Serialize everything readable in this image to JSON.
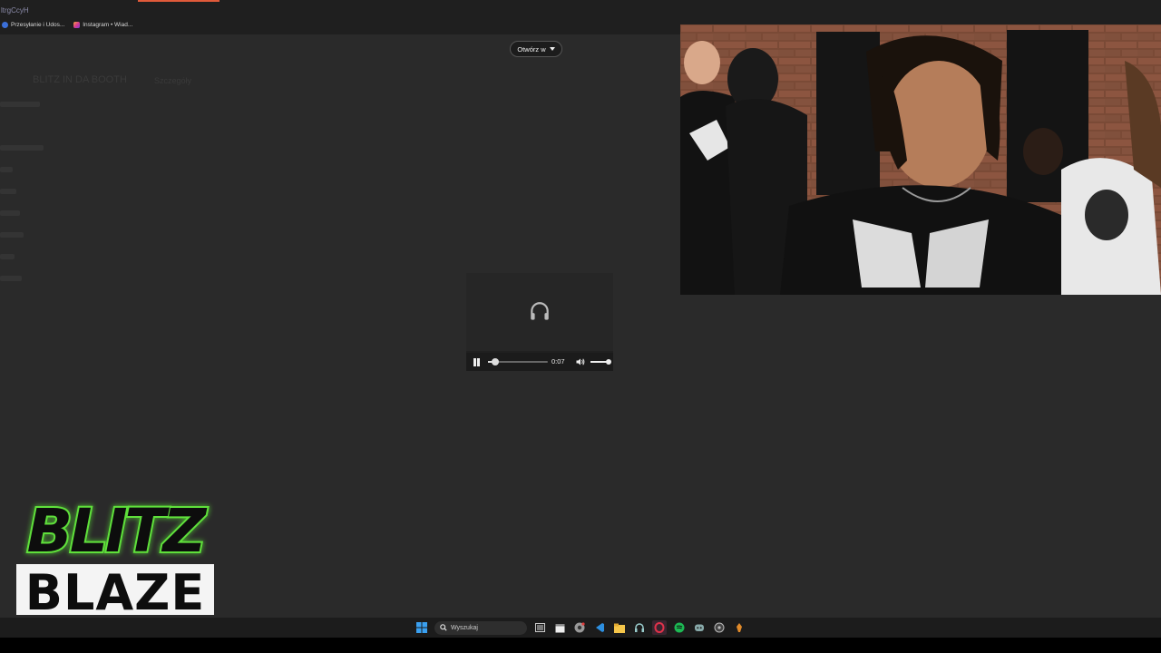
{
  "browser": {
    "url_fragment": "ltrgCcyH",
    "bookmarks": [
      {
        "label": "Przesyłanie i Udos...",
        "icon": "facebook-icon"
      },
      {
        "label": "Instagram • Wiad...",
        "icon": "instagram-icon"
      }
    ]
  },
  "page": {
    "open_in_label": "Otwórz w",
    "dim_title": "BLITZ IN DA BOOTH",
    "dim_subtitle": "Szczegóły"
  },
  "audio_player": {
    "time": "0:07",
    "progress": 0.12,
    "volume": 1.0
  },
  "logo": {
    "line1": "BLITZ",
    "line2": "BLAZE"
  },
  "taskbar": {
    "search_placeholder": "Wyszukaj",
    "apps": [
      "start-icon",
      "search-icon",
      "task-view-icon",
      "calendar-icon",
      "chrome-icon",
      "vscode-icon",
      "file-explorer-icon",
      "headset-icon",
      "opera-icon",
      "spotify-icon",
      "discord-icon",
      "obs-icon",
      "cs-icon"
    ]
  },
  "colors": {
    "logo_green": "#5ee03a",
    "accent_tab": "#e05a3a",
    "spotify": "#1db954"
  }
}
